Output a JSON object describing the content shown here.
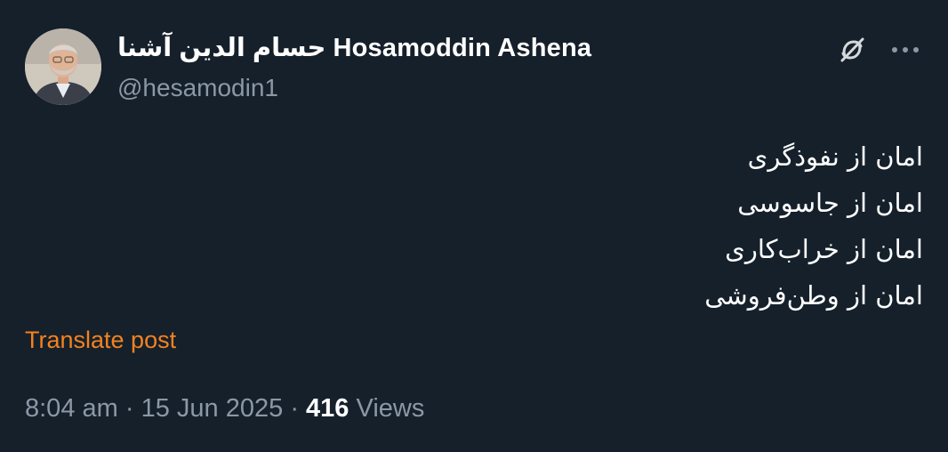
{
  "tweet": {
    "author": {
      "display_name": "حسام الدين آشنا Hosamoddin Ashena",
      "handle": "@hesamodin1"
    },
    "text_lines": [
      "امان از نفوذگری",
      "امان از جاسوسی",
      "امان از خراب‌کاری",
      "امان از وطن‌فروشی"
    ],
    "translate_label": "Translate post",
    "time": "8:04 am",
    "separator": "·",
    "date": "15 Jun 2025",
    "views_count": "416",
    "views_label": "Views"
  },
  "icons": {
    "grok": "grok-icon",
    "more": "more-options-icon"
  },
  "colors": {
    "background": "#15202b",
    "secondary_text": "#8b98a5",
    "translate_link": "#f4821f"
  }
}
